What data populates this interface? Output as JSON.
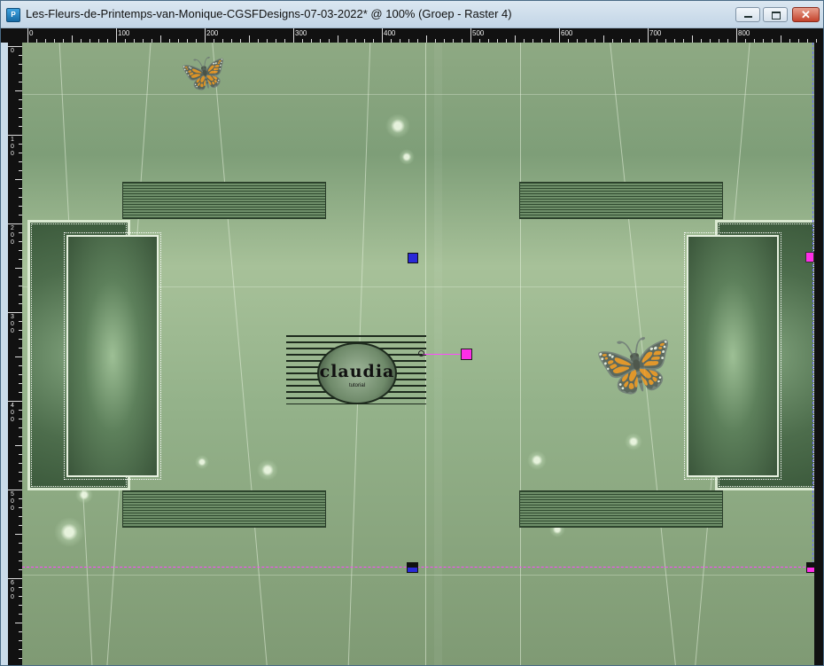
{
  "window": {
    "title": "Les-Fleurs-de-Printemps-van-Monique-CGSFDesigns-07-03-2022* @ 100% (Groep - Raster 4)",
    "app_icon_glyph": "P",
    "controls": {
      "close_glyph": "✕"
    }
  },
  "ruler": {
    "horizontal_labels": [
      "0",
      "100",
      "200",
      "300",
      "400",
      "500",
      "600",
      "700",
      "800"
    ],
    "vertical_labels": [
      "0",
      "1\n0\n0",
      "2\n0\n0",
      "3\n0\n0",
      "4\n0\n0",
      "5\n0\n0",
      "6\n0\n0"
    ]
  },
  "watermark": {
    "text": "claudia",
    "subtext": "tutorial"
  },
  "colors": {
    "guide_horizontal": "#ff48ff",
    "guide_vertical": "#6a6aff",
    "handle_magenta": "#ff2ee8",
    "handle_blue": "#2a2ad8"
  },
  "icons": [
    "app-icon",
    "minimize-icon",
    "maximize-icon",
    "close-icon",
    "butterfly-icon"
  ]
}
